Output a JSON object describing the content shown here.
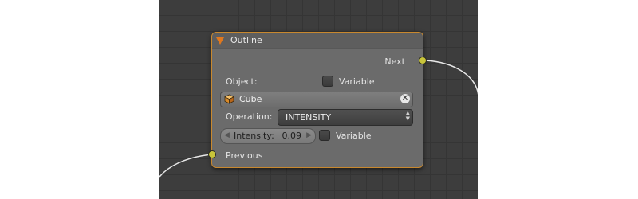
{
  "node": {
    "title": "Outline",
    "outputs": {
      "next_label": "Next"
    },
    "inputs": {
      "previous_label": "Previous"
    },
    "object": {
      "label": "Object:",
      "variable_label": "Variable",
      "value": "Cube",
      "icon": "cube-icon",
      "clear_icon": "close-icon"
    },
    "operation": {
      "label": "Operation:",
      "value": "INTENSITY"
    },
    "intensity": {
      "label": "Intensity:",
      "value": "0.09",
      "variable_label": "Variable"
    }
  },
  "colors": {
    "canvas": "#3d3d3d",
    "node_body": "#6b6b6b",
    "node_border": "#c8882e",
    "collapse_arrow": "#e0781e",
    "socket": "#c8c43a",
    "link": "#e8e8e8"
  }
}
